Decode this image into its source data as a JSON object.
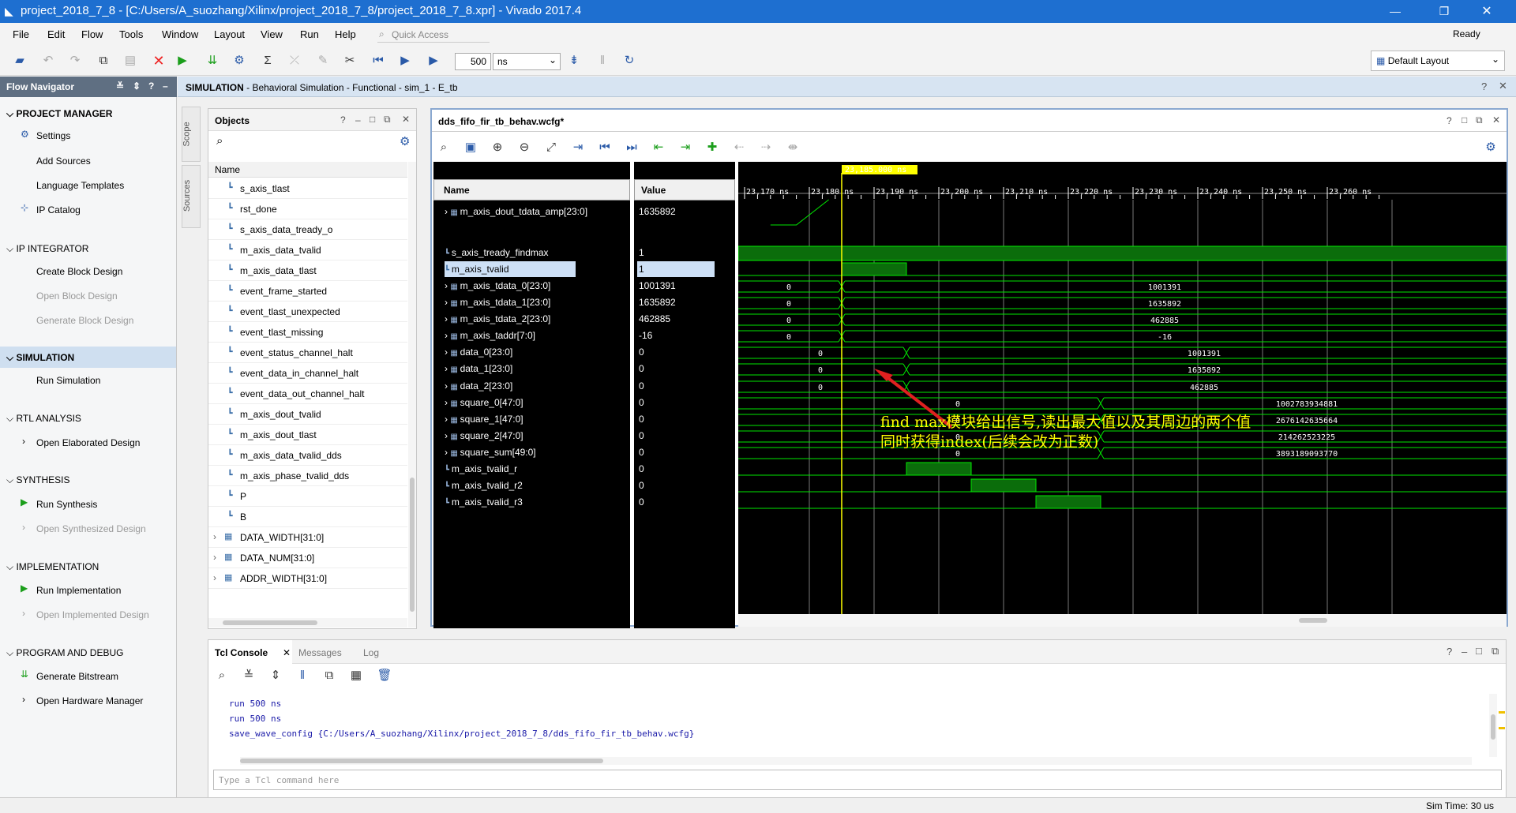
{
  "window": {
    "title": "project_2018_7_8 - [C:/Users/A_suozhang/Xilinx/project_2018_7_8/project_2018_7_8.xpr] - Vivado 2017.4"
  },
  "menu": [
    "File",
    "Edit",
    "Flow",
    "Tools",
    "Window",
    "Layout",
    "View",
    "Run",
    "Help"
  ],
  "quick_access": {
    "placeholder": "Quick Access"
  },
  "status_ready": "Ready",
  "toolbar": {
    "run_value": "500",
    "run_unit": "ns",
    "layout": "Default Layout"
  },
  "flow_nav": {
    "title": "Flow Navigator",
    "sections": [
      {
        "label": "PROJECT MANAGER",
        "items": [
          "Settings",
          "Add Sources",
          "Language Templates",
          "IP Catalog"
        ]
      },
      {
        "label": "IP INTEGRATOR",
        "items": [
          "Create Block Design",
          "Open Block Design",
          "Generate Block Design"
        ]
      },
      {
        "label": "SIMULATION",
        "items": [
          "Run Simulation"
        ]
      },
      {
        "label": "RTL ANALYSIS",
        "items": [
          "Open Elaborated Design"
        ]
      },
      {
        "label": "SYNTHESIS",
        "items": [
          "Run Synthesis",
          "Open Synthesized Design"
        ]
      },
      {
        "label": "IMPLEMENTATION",
        "items": [
          "Run Implementation",
          "Open Implemented Design"
        ]
      },
      {
        "label": "PROGRAM AND DEBUG",
        "items": [
          "Generate Bitstream",
          "Open Hardware Manager"
        ]
      }
    ]
  },
  "sim_header": {
    "prefix": "SIMULATION",
    "text": " - Behavioral Simulation - Functional - sim_1 - E_tb"
  },
  "side_tabs": {
    "scope": "Scope",
    "sources": "Sources"
  },
  "objects": {
    "title": "Objects",
    "column": "Name",
    "items": [
      "s_axis_tlast",
      "rst_done",
      "s_axis_data_tready_o",
      "m_axis_data_tvalid",
      "m_axis_data_tlast",
      "event_frame_started",
      "event_tlast_unexpected",
      "event_tlast_missing",
      "event_status_channel_halt",
      "event_data_in_channel_halt",
      "event_data_out_channel_halt",
      "m_axis_dout_tvalid",
      "m_axis_dout_tlast",
      "m_axis_data_tvalid_dds",
      "m_axis_phase_tvalid_dds",
      "P",
      "B",
      "DATA_WIDTH[31:0]",
      "DATA_NUM[31:0]",
      "ADDR_WIDTH[31:0]"
    ]
  },
  "wave": {
    "tab": "dds_fifo_fir_tb_behav.wcfg*",
    "name_header": "Name",
    "value_header": "Value",
    "cursor_label": "23,185.000 ns",
    "time_ticks": [
      "23,170 ns",
      "23,180 ns",
      "23,190 ns",
      "23,200 ns",
      "23,210 ns",
      "23,220 ns",
      "23,230 ns",
      "23,240 ns",
      "23,250 ns",
      "23,260 ns"
    ],
    "signals": [
      {
        "name": "m_axis_dout_tdata_amp[23:0]",
        "value": "1635892"
      },
      {
        "name": "s_axis_tready_findmax",
        "value": "1"
      },
      {
        "name": "m_axis_tvalid",
        "value": "1"
      },
      {
        "name": "m_axis_tdata_0[23:0]",
        "value": "1001391"
      },
      {
        "name": "m_axis_tdata_1[23:0]",
        "value": "1635892"
      },
      {
        "name": "m_axis_tdata_2[23:0]",
        "value": "462885"
      },
      {
        "name": "m_axis_taddr[7:0]",
        "value": "-16"
      },
      {
        "name": "data_0[23:0]",
        "value": "0"
      },
      {
        "name": "data_1[23:0]",
        "value": "0"
      },
      {
        "name": "data_2[23:0]",
        "value": "0"
      },
      {
        "name": "square_0[47:0]",
        "value": "0"
      },
      {
        "name": "square_1[47:0]",
        "value": "0"
      },
      {
        "name": "square_2[47:0]",
        "value": "0"
      },
      {
        "name": "square_sum[49:0]",
        "value": "0"
      },
      {
        "name": "m_axis_tvalid_r",
        "value": "0"
      },
      {
        "name": "m_axis_tvalid_r2",
        "value": "0"
      },
      {
        "name": "m_axis_tvalid_r3",
        "value": "0"
      }
    ],
    "bus_labels": {
      "zero": "0",
      "tdata0": "1001391",
      "tdata1": "1635892",
      "tdata2": "462885",
      "taddr": "-16",
      "d0": "1001391",
      "d1": "1635892",
      "d2": "462885",
      "sq0": "1002783934881",
      "sq1": "2676142635664",
      "sq2": "214262523225",
      "sqs": "3893189093770"
    },
    "annotation": {
      "line1": "find max模块给出信号,读出最大值以及其周边的两个值",
      "line2": "同时获得index(后续会改为正数)"
    },
    "colors": {
      "signal": "#00e600",
      "cursor": "#ffff00",
      "annotation": "#ffff00",
      "arrow": "#e02020"
    }
  },
  "tcl": {
    "tabs": [
      "Tcl Console",
      "Messages",
      "Log"
    ],
    "lines": [
      "run 500 ns",
      "run 500 ns",
      "save_wave_config {C:/Users/A_suozhang/Xilinx/project_2018_7_8/dds_fifo_fir_tb_behav.wcfg}"
    ],
    "placeholder": "Type a Tcl command here"
  },
  "status": {
    "sim_time": "Sim Time: 30 us"
  }
}
